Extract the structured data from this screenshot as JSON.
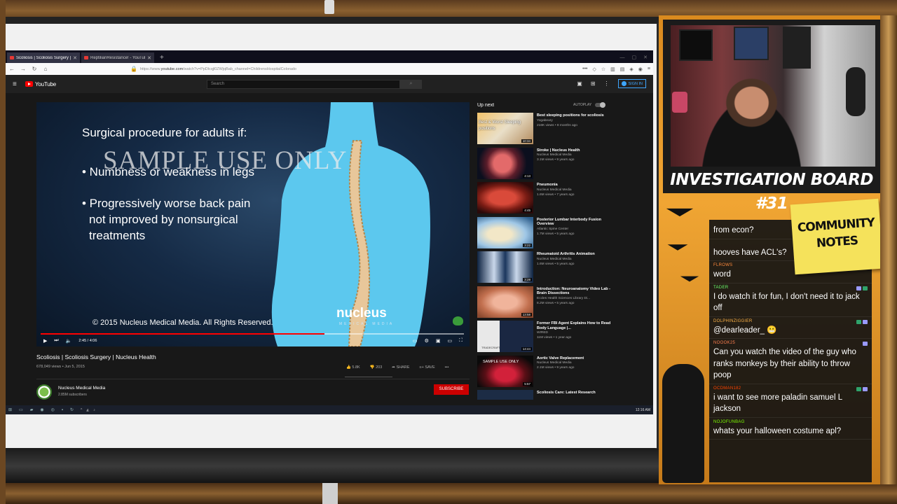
{
  "browser": {
    "tabs": [
      {
        "label": "Scoliosis | Scoliosis Surgery | N...",
        "active": true
      },
      {
        "label": "ReptilianResistance! - YouTube",
        "active": false
      }
    ],
    "new_tab": "+",
    "url_prefix": "https://www.",
    "url_domain": "youtube.com",
    "url_rest": "/watch?v=PpDlcqjl0ZWjqBab_channel=ChildrensHospitalColorado"
  },
  "youtube": {
    "logo_text": "YouTube",
    "search_placeholder": "Search",
    "signin_label": "SIGN IN",
    "player": {
      "slide_title": "Surgical procedure for adults if:",
      "bullet1": "• Numbness or weakness in legs",
      "bullet2_line1": "• Progressively worse back pain",
      "bullet2_line2": "not improved by nonsurgical",
      "bullet2_line3": "treatments",
      "watermark": "SAMPLE USE ONLY",
      "copyright": "© 2015 Nucleus Medical Media.  All Rights Reserved.",
      "brand": "nucleus",
      "brand_sub": "MEDICAL MEDIA",
      "time": "2:45 / 4:06",
      "progress_fraction": 0.67,
      "buffered_fraction": 1.0
    },
    "video": {
      "title": "Scoliosis | Scoliosis Surgery | Nucleus Health",
      "meta": "678,049 views • Jun 5, 2015",
      "likes": "5.8K",
      "dislikes": "203",
      "share": "SHARE",
      "save": "SAVE",
      "more": "•••"
    },
    "channel": {
      "name": "Nucleus Medical Media",
      "subs": "2.85M subscribers",
      "subscribe": "SUBSCRIBE"
    },
    "upnext": {
      "label": "Up next",
      "autoplay": "AUTOPLAY",
      "items": [
        {
          "title": "Best sleeping positions for scoliosis",
          "channel": "Yogabeary",
          "stats": "216K views • 8 months ago",
          "duration": "10:34",
          "thumb_text": "Best & Worst Sleeping positions"
        },
        {
          "title": "Stroke | Nucleus Health",
          "channel": "Nucleus Medical Media",
          "stats": "3.1M views • 9 years ago",
          "duration": "4:13"
        },
        {
          "title": "Pneumonia",
          "channel": "Nucleus Medical Media",
          "stats": "1.6M views • 7 years ago",
          "duration": "4:45"
        },
        {
          "title": "Posterior Lumbar Interbody Fusion Overview",
          "channel": "Atlantic Spine Center",
          "stats": "1.7M views • 5 years ago",
          "duration": "3:22"
        },
        {
          "title": "Rheumatoid Arthritis Animation",
          "channel": "Nucleus Medical Media",
          "stats": "1.6M views • 5 years ago",
          "duration": "3:28"
        },
        {
          "title": "Introduction: Neuroanatomy Video Lab - Brain Dissections",
          "channel": "Eccles Health Sciences Library Di...",
          "stats": "8.2M views • 5 years ago",
          "duration": "13:58"
        },
        {
          "title": "Former FBI Agent Explains How to Read Body Language |...",
          "channel": "WIRED",
          "stats": "11M views • 1 year ago",
          "duration": "14:44",
          "thumb_text": "TRADECRAFT"
        },
        {
          "title": "Aortic Valve Replacement",
          "channel": "Nucleus Medical Media",
          "stats": "2.1M views • 9 years ago",
          "duration": "5:57",
          "thumb_text": "SAMPLE USE ONLY"
        },
        {
          "title": "Scoliosis Care: Latest Research",
          "channel": "",
          "stats": "",
          "duration": ""
        }
      ]
    }
  },
  "taskbar": {
    "clock": "12:16 AM"
  },
  "stream": {
    "board_title": "INVESTIGATION BOARD #31",
    "sticky_line1": "COMMUNITY",
    "sticky_line2": "NOTES",
    "chat": [
      {
        "user": "",
        "color": "#c9b6ff",
        "text": "from econ?"
      },
      {
        "user": "",
        "color": "#ff3fa6",
        "text": "hooves have ACL's?"
      },
      {
        "user": "FLROWS",
        "color": "#ff8a3d",
        "text": "word"
      },
      {
        "user": "TADER",
        "color": "#6cff6c",
        "text": "I do watch it for fun, I don't need it to jack off"
      },
      {
        "user": "DOLPHINZIGGIER",
        "color": "#ffb347",
        "text": "@dearleader_ 😬"
      },
      {
        "user": "NOOOK25",
        "color": "#ff7f50",
        "text": "Can you watch the video of the guy who ranks monkeys by their ability to throw poop"
      },
      {
        "user": "OCDMAN182",
        "color": "#ff4500",
        "text": "i want to see more paladin samuel L jackson"
      },
      {
        "user": "NOJOFUNBAG",
        "color": "#7cfc00",
        "text": "whats your halloween costume apl?"
      }
    ]
  },
  "colors": {
    "accent_red": "#ff0000",
    "subscribe_red": "#cc0000",
    "link_blue": "#3ea6ff",
    "sticky_yellow": "#f5e25b"
  }
}
